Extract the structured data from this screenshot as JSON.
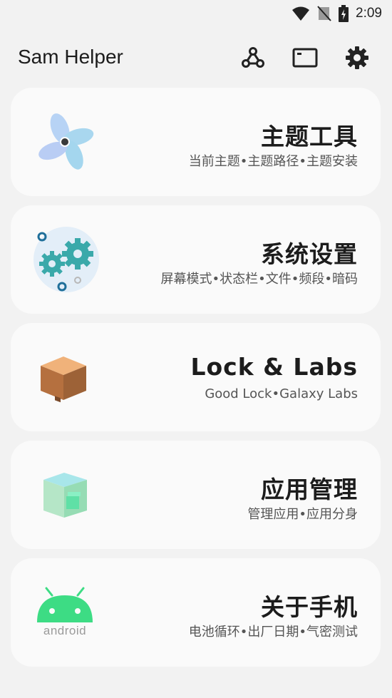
{
  "status": {
    "time": "2:09"
  },
  "app": {
    "title": "Sam Helper"
  },
  "actions": [
    {
      "name": "network-icon"
    },
    {
      "name": "window-icon"
    },
    {
      "name": "settings-icon"
    }
  ],
  "cards": [
    {
      "title": "主题工具",
      "subtitle": "当前主题•主题路径•主题安装",
      "icon": "pinwheel-icon"
    },
    {
      "title": "系统设置",
      "subtitle": "屏幕模式•状态栏•文件•频段•暗码",
      "icon": "gears-icon"
    },
    {
      "title": "Lock & Labs",
      "subtitle": "Good Lock•Galaxy Labs",
      "icon": "box-icon"
    },
    {
      "title": "应用管理",
      "subtitle": "管理应用•应用分身",
      "icon": "cube-icon"
    },
    {
      "title": "关于手机",
      "subtitle": "电池循环•出厂日期•气密测试",
      "icon": "android-icon",
      "icon_text": "android"
    }
  ]
}
